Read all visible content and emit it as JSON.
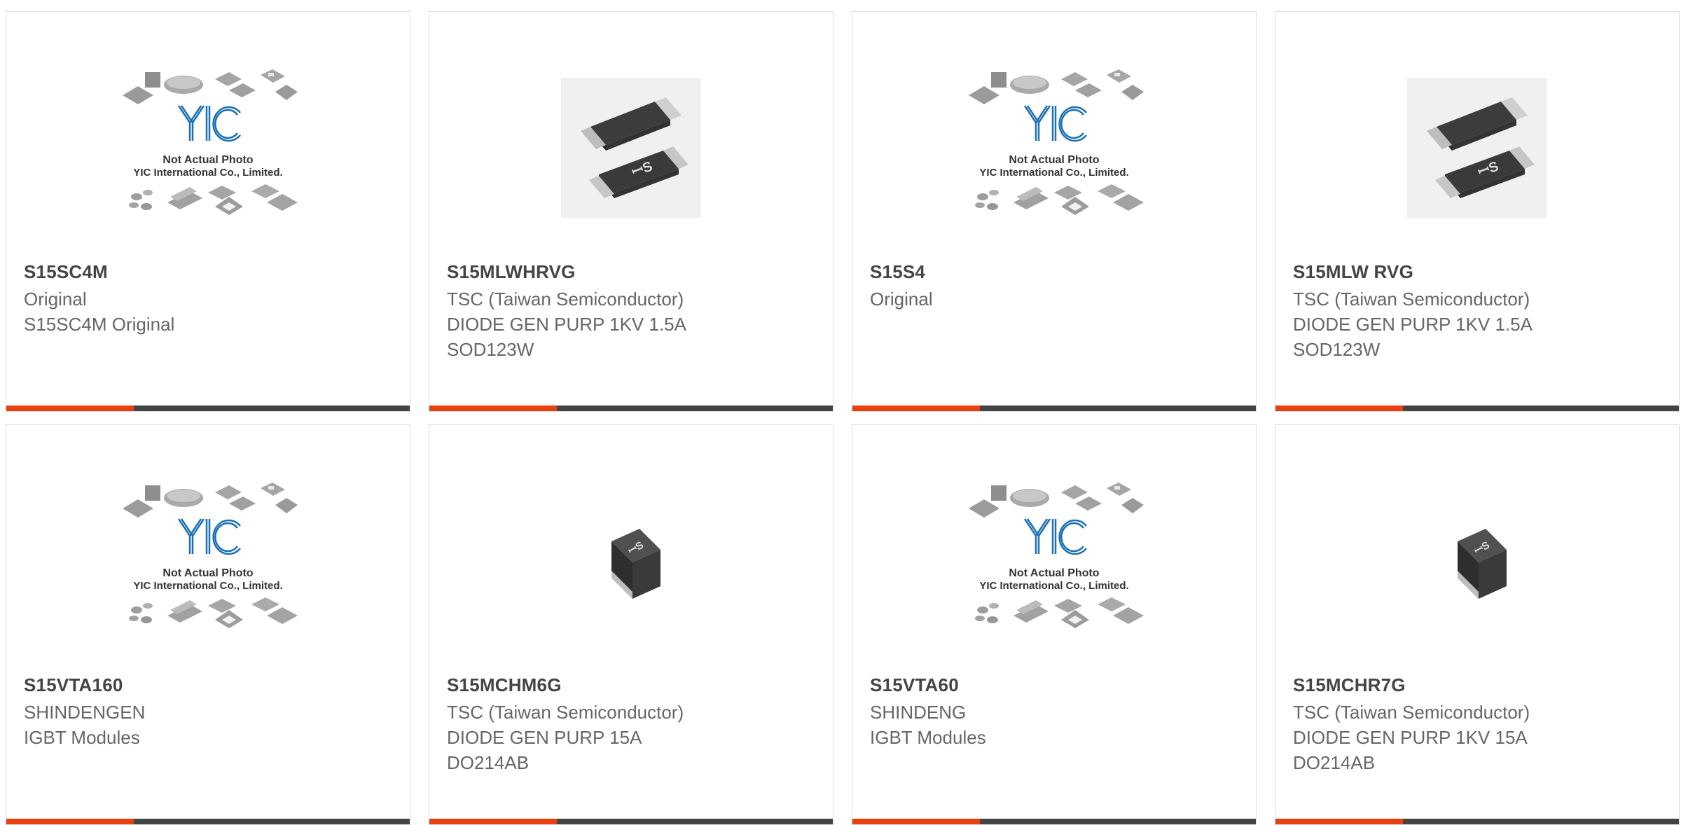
{
  "placeholder": {
    "line1": "Not Actual Photo",
    "line2": "YIC International Co., Limited."
  },
  "cards": [
    {
      "part": "S15SC4M",
      "lines": [
        "Original",
        "S15SC4M Original",
        ""
      ],
      "image": "yic-placeholder-image"
    },
    {
      "part": "S15MLWHRVG",
      "lines": [
        "TSC (Taiwan Semiconductor)",
        "DIODE GEN PURP 1KV 1.5A",
        "SOD123W"
      ],
      "image": "sod123w-package-image"
    },
    {
      "part": "S15S4",
      "lines": [
        "Original",
        "",
        ""
      ],
      "image": "yic-placeholder-image"
    },
    {
      "part": "S15MLW RVG",
      "lines": [
        "TSC (Taiwan Semiconductor)",
        "DIODE GEN PURP 1KV 1.5A",
        "SOD123W"
      ],
      "image": "sod123w-package-image"
    },
    {
      "part": "S15VTA160",
      "lines": [
        "SHINDENGEN",
        "IGBT Modules",
        ""
      ],
      "image": "yic-placeholder-image"
    },
    {
      "part": "S15MCHM6G",
      "lines": [
        "TSC (Taiwan Semiconductor)",
        "DIODE GEN PURP 15A",
        "DO214AB"
      ],
      "image": "do214ab-package-image"
    },
    {
      "part": "S15VTA60",
      "lines": [
        "SHINDENG",
        "IGBT Modules",
        ""
      ],
      "image": "yic-placeholder-image"
    },
    {
      "part": "S15MCHR7G",
      "lines": [
        "TSC (Taiwan Semiconductor)",
        "DIODE GEN PURP 1KV 15A",
        "DO214AB"
      ],
      "image": "do214ab-package-image"
    }
  ],
  "colors": {
    "accent": "#e8410f",
    "bar": "#444444",
    "logo": "#1a6fb5"
  }
}
